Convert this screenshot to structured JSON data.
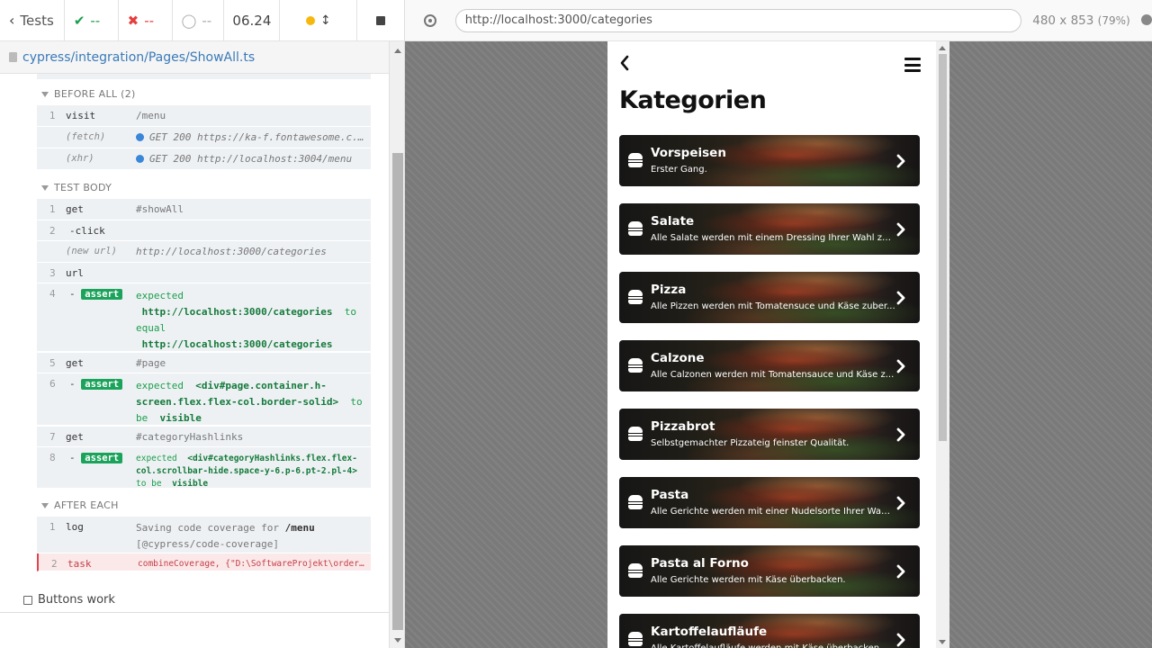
{
  "reporter": {
    "header": {
      "tests_label": "Tests",
      "passed": "--",
      "failed": "--",
      "pending": "--",
      "duration": "06.24"
    },
    "spec_path": "cypress/integration/Pages/ShowAll.ts",
    "before_all": {
      "title": "BEFORE ALL (2)",
      "commands": [
        {
          "num": "1",
          "name": "visit",
          "message": "/menu"
        },
        {
          "num": "",
          "name": "(fetch)",
          "message": "GET 200 https://ka-f.fontawesome.c..."
        },
        {
          "num": "",
          "name": "(xhr)",
          "message": "GET 200 http://localhost:3004/menu"
        }
      ]
    },
    "test_body": {
      "title": "TEST BODY",
      "cmd1": {
        "num": "1",
        "name": "get",
        "message": "#showAll"
      },
      "cmd2": {
        "num": "2",
        "name": "-click"
      },
      "new_url": {
        "name": "(new url)",
        "message": "http://localhost:3000/categories"
      },
      "cmd3": {
        "num": "3",
        "name": "url"
      },
      "cmd4": {
        "num": "4",
        "badge": "assert",
        "line1": "expected",
        "line2": "http://localhost:3000/categories",
        "line2_suffix": "to",
        "line3": "equal",
        "line4": "http://localhost:3000/categories"
      },
      "cmd5": {
        "num": "5",
        "name": "get",
        "message": "#page"
      },
      "cmd6": {
        "num": "6",
        "badge": "assert",
        "line1_prefix": "expected",
        "line1": "<div#page.container.h-",
        "line2": "screen.flex.flex-col.border-solid>",
        "line2_suffix": "to",
        "line3_prefix": "be",
        "line3": "visible"
      },
      "cmd7": {
        "num": "7",
        "name": "get",
        "message": "#categoryHashlinks"
      },
      "cmd8": {
        "num": "8",
        "badge": "assert",
        "line1_prefix": "expected",
        "line1": "<div#categoryHashlinks.flex.flex-",
        "line2": "col.scrollbar-hide.space-y-6.p-6.pt-2.pl-4>",
        "line3_prefix": "to be",
        "line3": "visible"
      }
    },
    "after_each": {
      "title": "AFTER EACH",
      "cmd1": {
        "num": "1",
        "name": "log",
        "message_prefix": "Saving code coverage for",
        "message_bold": "/menu",
        "message_line2": "[@cypress/code-coverage]"
      },
      "cmd2": {
        "num": "2",
        "name": "task",
        "message": "combineCoverage, {\"D:\\SoftwareProjekt\\order-..."
      }
    },
    "test_title": "Buttons work"
  },
  "aut": {
    "url": "http://localhost:3000/categories",
    "viewport": "480 x 853",
    "scale": "(79%)"
  },
  "app": {
    "title": "Kategorien",
    "categories": [
      {
        "name": "Vorspeisen",
        "desc": "Erster Gang."
      },
      {
        "name": "Salate",
        "desc": "Alle Salate werden mit einem Dressing Ihrer Wahl zu..."
      },
      {
        "name": "Pizza",
        "desc": "Alle Pizzen werden mit Tomatensuce und Käse zuber..."
      },
      {
        "name": "Calzone",
        "desc": "Alle Calzonen werden mit Tomatensauce und Käse z..."
      },
      {
        "name": "Pizzabrot",
        "desc": "Selbstgemachter Pizzateig feinster Qualität."
      },
      {
        "name": "Pasta",
        "desc": "Alle Gerichte werden mit einer Nudelsorte Ihrer Wahl..."
      },
      {
        "name": "Pasta al Forno",
        "desc": "Alle Gerichte werden mit Käse überbacken."
      },
      {
        "name": "Kartoffelaufläufe",
        "desc": "Alle Kartoffelaufläufe werden mit Käse überbacken."
      }
    ]
  },
  "colors": {
    "pass_green": "#1b9e4b",
    "fail_red": "#e53e3e",
    "link_blue": "#3a7ab8",
    "assert_badge": "#1ba35b"
  }
}
